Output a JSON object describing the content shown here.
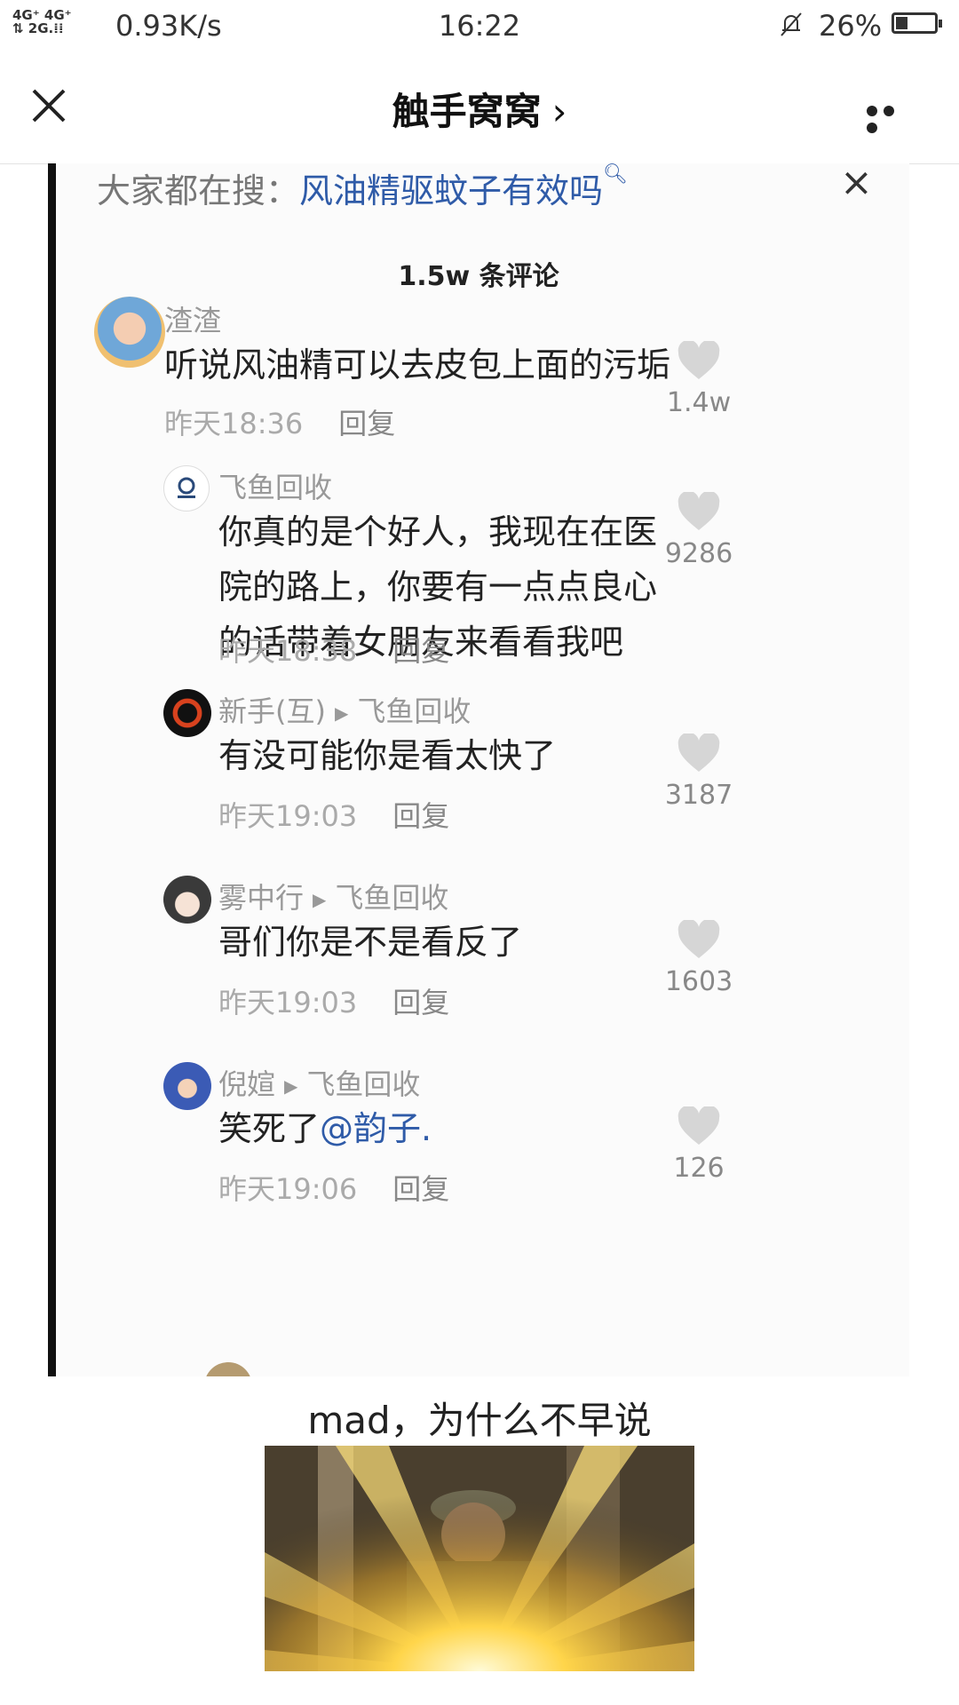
{
  "statusbar": {
    "signal": "4G⁺ 4G⁺",
    "signal2": "⇅ 2G.⁞⁞",
    "speed": "0.93K/s",
    "time": "16:22",
    "battery": "26%"
  },
  "navbar": {
    "title": "触手窝窝",
    "chevron": "›"
  },
  "search": {
    "prefix": "大家都在搜：",
    "query": "风油精驱蚊子有效吗",
    "close": "×"
  },
  "comment_count": "1.5w 条评论",
  "comments": [
    {
      "user": "渣渣",
      "reply_to": "",
      "text": "听说风油精可以去皮包上面的污垢",
      "time": "昨天18:36",
      "reply": "回复",
      "likes": "1.4w",
      "avatar_icon": "baby-avatar"
    },
    {
      "user": "飞鱼回收",
      "reply_to": "",
      "text": "你真的是个好人，我现在在医院的路上，你要有一点点良心的话带着女朋友来看看我吧",
      "time": "昨天18:38",
      "reply": "回复",
      "likes": "9286",
      "avatar_icon": "logo-avatar"
    },
    {
      "user": "新手(互)",
      "reply_to": "飞鱼回收",
      "text": "有没可能你是看太快了",
      "time": "昨天19:03",
      "reply": "回复",
      "likes": "3187",
      "avatar_icon": "ring-avatar"
    },
    {
      "user": "雾中行",
      "reply_to": "飞鱼回收",
      "text": "哥们你是不是看反了",
      "time": "昨天19:03",
      "reply": "回复",
      "likes": "1603",
      "avatar_icon": "anime-avatar"
    },
    {
      "user": "倪媗",
      "reply_to": "飞鱼回收",
      "text": "笑死了",
      "mention": "@韵子.",
      "time": "昨天19:06",
      "reply": "回复",
      "likes": "126",
      "avatar_icon": "teletubby-avatar"
    }
  ],
  "caption": "mad，为什么不早说",
  "colors": {
    "link": "#2f5ba8",
    "heart": "#d6d6d6",
    "meta": "#aaaaaa"
  }
}
